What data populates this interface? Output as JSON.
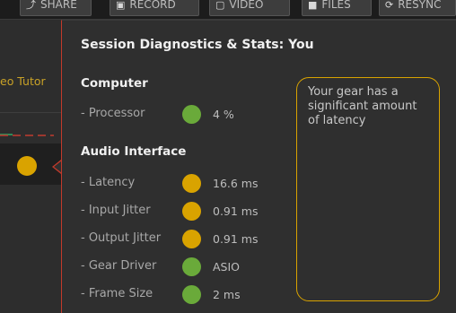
{
  "toolbar": {
    "buttons": [
      {
        "label": "SHARE",
        "icon": "share-icon"
      },
      {
        "label": "RECORD",
        "icon": "record-icon"
      },
      {
        "label": "VIDEO",
        "icon": "video-icon"
      },
      {
        "label": "FILES",
        "icon": "files-icon"
      },
      {
        "label": "RESYNC",
        "icon": "resync-icon"
      }
    ]
  },
  "left": {
    "tab_text": "eo Tutor"
  },
  "popup": {
    "title": "Session Diagnostics & Stats: You",
    "computer": {
      "heading": "Computer",
      "rows": [
        {
          "label": "- Processor",
          "value": "4 %",
          "status": "good"
        }
      ]
    },
    "audio": {
      "heading": "Audio Interface",
      "rows": [
        {
          "label": "- Latency",
          "value": "16.6 ms",
          "status": "warn"
        },
        {
          "label": "- Input Jitter",
          "value": "0.91 ms",
          "status": "warn"
        },
        {
          "label": "- Output Jitter",
          "value": "0.91 ms",
          "status": "warn"
        },
        {
          "label": "- Gear Driver",
          "value": "ASIO",
          "status": "good"
        },
        {
          "label": "- Frame Size",
          "value": "2 ms",
          "status": "good"
        }
      ]
    },
    "note": "Your gear has a significant amount of latency"
  },
  "colors": {
    "good": "#6aaa3a",
    "warn": "#d9a300",
    "accent_border": "#c23a2b",
    "note_border": "#d9a300"
  }
}
